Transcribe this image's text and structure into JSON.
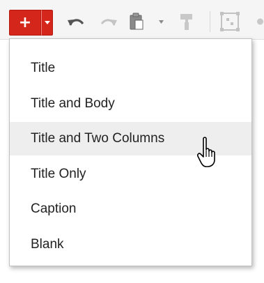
{
  "toolbar": {
    "new_slide_symbol": "+",
    "icons": [
      "plus-icon",
      "dropdown-arrow-icon",
      "undo-icon",
      "redo-icon",
      "paste-icon",
      "paint-format-icon",
      "select-layout-icon"
    ],
    "accent_color": "#d5261b"
  },
  "menu": {
    "items": [
      {
        "label": "Title"
      },
      {
        "label": "Title and Body"
      },
      {
        "label": "Title and Two Columns"
      },
      {
        "label": "Title Only"
      },
      {
        "label": "Caption"
      },
      {
        "label": "Blank"
      }
    ],
    "hovered_item": "Title and Two Columns",
    "hover_color": "#eeeeee"
  }
}
